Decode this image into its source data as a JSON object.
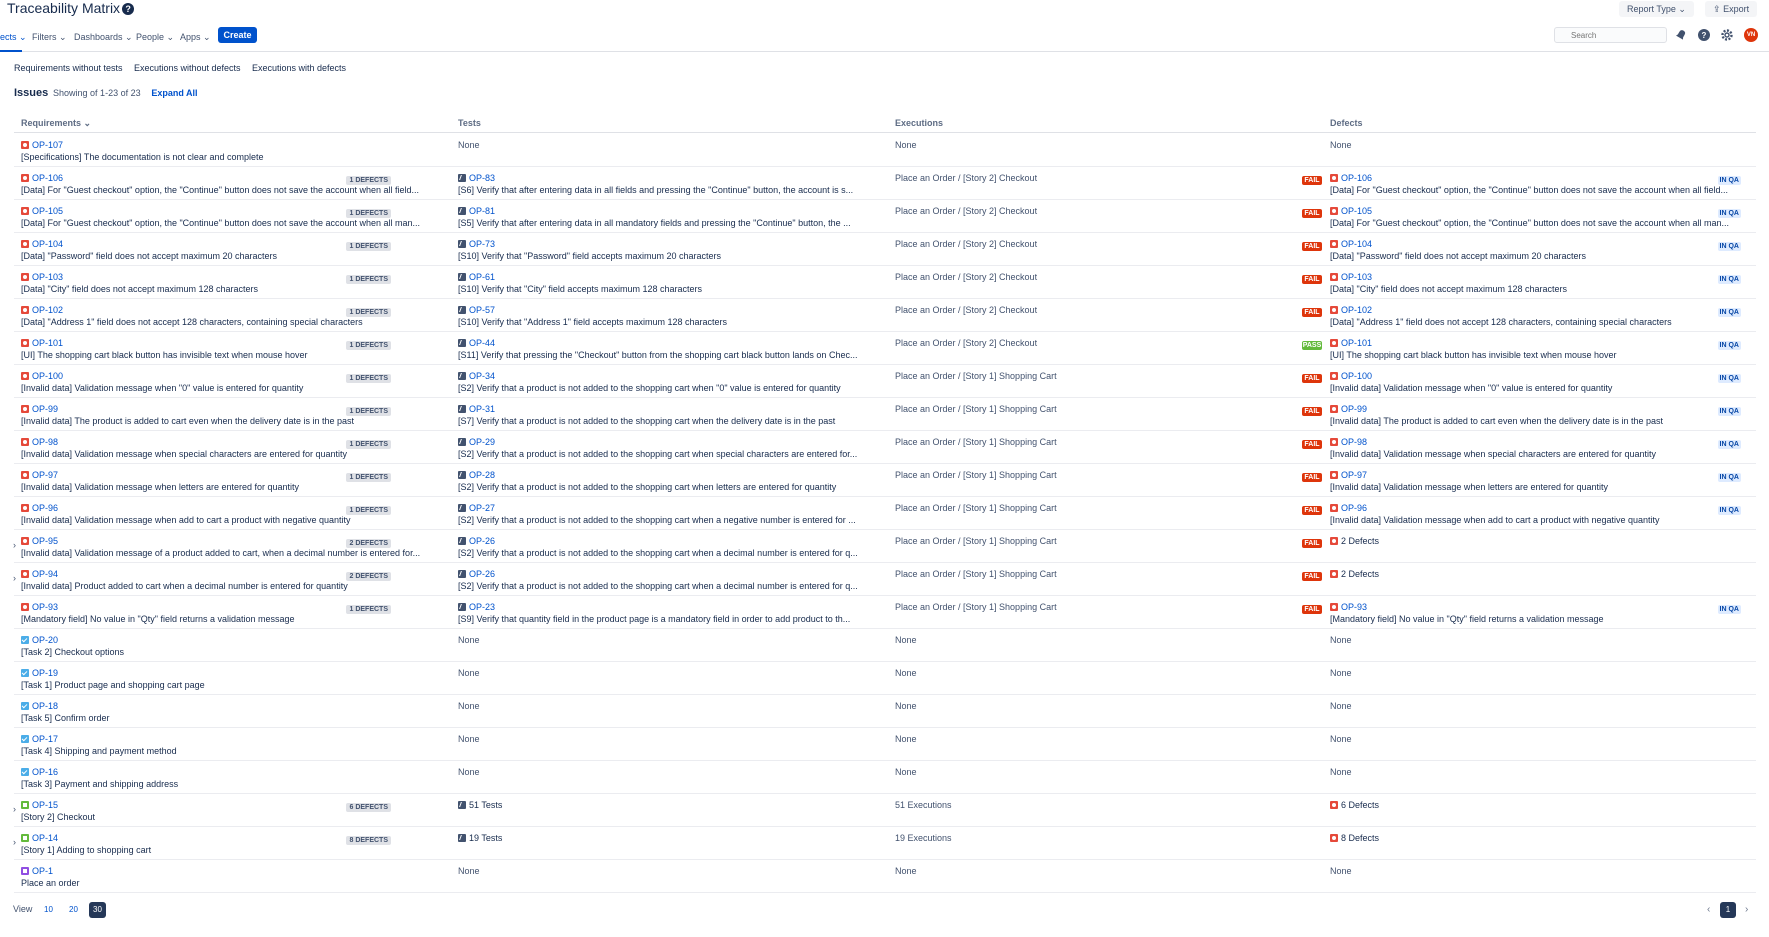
{
  "header": {
    "title": "Traceability Matrix",
    "report_type": "Report Type",
    "export": "Export"
  },
  "nav": {
    "items": [
      "ects",
      "Filters",
      "Dashboards",
      "People",
      "Apps"
    ],
    "create": "Create",
    "search_placeholder": "Search",
    "avatar_initials": "VN"
  },
  "subtabs": [
    "Requirements without tests",
    "Executions without defects",
    "Executions with defects"
  ],
  "issues": {
    "label": "Issues",
    "count": "Showing of 1-23 of 23",
    "expand": "Expand All"
  },
  "columns": {
    "req": "Requirements",
    "tests": "Tests",
    "exec": "Executions",
    "defects": "Defects"
  },
  "rows": [
    {
      "rkey": "OP-107",
      "rtitle": "[Specifications] The documentation is not clear and complete",
      "ricon": "bug",
      "badge": "",
      "tkey": "",
      "ttitle": "None",
      "exec": "None",
      "status": "",
      "dkey": "",
      "dtitle": "None",
      "dstatus": "",
      "expand": false
    },
    {
      "rkey": "OP-106",
      "rtitle": "[Data] For \"Guest checkout\" option, the \"Continue\" button does not save the account when all field...",
      "ricon": "bug",
      "badge": "1 DEFECTS",
      "tkey": "OP-83",
      "ttitle": "[S6] Verify that after entering data in all fields and pressing the \"Continue\" button, the account is s...",
      "exec": "Place an Order / [Story 2] Checkout",
      "status": "FAIL",
      "dkey": "OP-106",
      "dtitle": "[Data] For \"Guest checkout\" option, the \"Continue\" button does not save the account when all field...",
      "dstatus": "IN QA",
      "expand": false
    },
    {
      "rkey": "OP-105",
      "rtitle": "[Data] For \"Guest checkout\" option, the \"Continue\" button does not save the account when all man...",
      "ricon": "bug",
      "badge": "1 DEFECTS",
      "tkey": "OP-81",
      "ttitle": "[S5] Verify that after entering data in all mandatory fields and pressing the \"Continue\" button, the ...",
      "exec": "Place an Order / [Story 2] Checkout",
      "status": "FAIL",
      "dkey": "OP-105",
      "dtitle": "[Data] For \"Guest checkout\" option, the \"Continue\" button does not save the account when all man...",
      "dstatus": "IN QA",
      "expand": false
    },
    {
      "rkey": "OP-104",
      "rtitle": "[Data] \"Password\" field does not accept maximum 20 characters",
      "ricon": "bug",
      "badge": "1 DEFECTS",
      "tkey": "OP-73",
      "ttitle": "[S10] Verify that \"Password\" field accepts maximum 20 characters",
      "exec": "Place an Order / [Story 2] Checkout",
      "status": "FAIL",
      "dkey": "OP-104",
      "dtitle": "[Data] \"Password\" field does not accept maximum 20 characters",
      "dstatus": "IN QA",
      "expand": false
    },
    {
      "rkey": "OP-103",
      "rtitle": "[Data] \"City\" field does not accept maximum 128 characters",
      "ricon": "bug",
      "badge": "1 DEFECTS",
      "tkey": "OP-61",
      "ttitle": "[S10] Verify that \"City\" field accepts maximum 128 characters",
      "exec": "Place an Order / [Story 2] Checkout",
      "status": "FAIL",
      "dkey": "OP-103",
      "dtitle": "[Data] \"City\" field does not accept maximum 128 characters",
      "dstatus": "IN QA",
      "expand": false
    },
    {
      "rkey": "OP-102",
      "rtitle": "[Data] \"Address 1\" field does not accept 128 characters, containing special characters",
      "ricon": "bug",
      "badge": "1 DEFECTS",
      "tkey": "OP-57",
      "ttitle": "[S10] Verify that \"Address 1\" field accepts maximum 128 characters",
      "exec": "Place an Order / [Story 2] Checkout",
      "status": "FAIL",
      "dkey": "OP-102",
      "dtitle": "[Data] \"Address 1\" field does not accept 128 characters, containing special characters",
      "dstatus": "IN QA",
      "expand": false
    },
    {
      "rkey": "OP-101",
      "rtitle": "[UI] The shopping cart black button has invisible text when mouse hover",
      "ricon": "bug",
      "badge": "1 DEFECTS",
      "tkey": "OP-44",
      "ttitle": "[S11] Verify that pressing the \"Checkout\" button from the shopping cart black button lands on Chec...",
      "exec": "Place an Order / [Story 2] Checkout",
      "status": "PASS",
      "dkey": "OP-101",
      "dtitle": "[UI] The shopping cart black button has invisible text when mouse hover",
      "dstatus": "IN QA",
      "expand": false
    },
    {
      "rkey": "OP-100",
      "rtitle": "[Invalid data] Validation message when \"0\" value is entered for quantity",
      "ricon": "bug",
      "badge": "1 DEFECTS",
      "tkey": "OP-34",
      "ttitle": "[S2] Verify that a product is not added to the shopping cart when \"0\" value is entered for quantity",
      "exec": "Place an Order / [Story 1] Shopping Cart",
      "status": "FAIL",
      "dkey": "OP-100",
      "dtitle": "[Invalid data] Validation message when \"0\" value is entered for quantity",
      "dstatus": "IN QA",
      "expand": false
    },
    {
      "rkey": "OP-99",
      "rtitle": "[Invalid data] The product is added to cart even when the delivery date is in the past",
      "ricon": "bug",
      "badge": "1 DEFECTS",
      "tkey": "OP-31",
      "ttitle": "[S7] Verify that a product is not added to the shopping cart when the delivery date is in the past",
      "exec": "Place an Order / [Story 1] Shopping Cart",
      "status": "FAIL",
      "dkey": "OP-99",
      "dtitle": "[Invalid data] The product is added to cart even when the delivery date is in the past",
      "dstatus": "IN QA",
      "expand": false
    },
    {
      "rkey": "OP-98",
      "rtitle": "[Invalid data] Validation message when special characters are entered for quantity",
      "ricon": "bug",
      "badge": "1 DEFECTS",
      "tkey": "OP-29",
      "ttitle": "[S2] Verify that a product is not added to the shopping cart when special characters are entered for...",
      "exec": "Place an Order / [Story 1] Shopping Cart",
      "status": "FAIL",
      "dkey": "OP-98",
      "dtitle": "[Invalid data] Validation message when special characters are entered for quantity",
      "dstatus": "IN QA",
      "expand": false
    },
    {
      "rkey": "OP-97",
      "rtitle": "[Invalid data] Validation message when letters are entered for quantity",
      "ricon": "bug",
      "badge": "1 DEFECTS",
      "tkey": "OP-28",
      "ttitle": "[S2] Verify that a product is not added to the shopping cart when letters are entered for quantity",
      "exec": "Place an Order / [Story 1] Shopping Cart",
      "status": "FAIL",
      "dkey": "OP-97",
      "dtitle": "[Invalid data] Validation message when letters are entered for quantity",
      "dstatus": "IN QA",
      "expand": false
    },
    {
      "rkey": "OP-96",
      "rtitle": "[Invalid data] Validation message when add to cart a product with negative quantity",
      "ricon": "bug",
      "badge": "1 DEFECTS",
      "tkey": "OP-27",
      "ttitle": "[S2] Verify that a product is not added to the shopping cart when a negative number is entered for ...",
      "exec": "Place an Order / [Story 1] Shopping Cart",
      "status": "FAIL",
      "dkey": "OP-96",
      "dtitle": "[Invalid data] Validation message when add to cart a product with negative quantity",
      "dstatus": "IN QA",
      "expand": false
    },
    {
      "rkey": "OP-95",
      "rtitle": "[Invalid data] Validation message of a product added to cart, when a decimal number is entered for...",
      "ricon": "bug",
      "badge": "2 DEFECTS",
      "tkey": "OP-26",
      "ttitle": "[S2] Verify that a product is not added to the shopping cart when a decimal number is entered for q...",
      "exec": "Place an Order / [Story 1] Shopping Cart",
      "status": "FAIL",
      "dkey": "2 Defects",
      "dtitle": "",
      "dstatus": "",
      "expand": true
    },
    {
      "rkey": "OP-94",
      "rtitle": "[Invalid data] Product added to cart when a decimal number is entered for quantity",
      "ricon": "bug",
      "badge": "2 DEFECTS",
      "tkey": "OP-26",
      "ttitle": "[S2] Verify that a product is not added to the shopping cart when a decimal number is entered for q...",
      "exec": "Place an Order / [Story 1] Shopping Cart",
      "status": "FAIL",
      "dkey": "2 Defects",
      "dtitle": "",
      "dstatus": "",
      "expand": true
    },
    {
      "rkey": "OP-93",
      "rtitle": "[Mandatory field] No value in \"Qty\" field returns a validation message",
      "ricon": "bug",
      "badge": "1 DEFECTS",
      "tkey": "OP-23",
      "ttitle": "[S9] Verify that quantity field in the product page is a mandatory field in order to add product to th...",
      "exec": "Place an Order / [Story 1] Shopping Cart",
      "status": "FAIL",
      "dkey": "OP-93",
      "dtitle": "[Mandatory field] No value in \"Qty\" field returns a validation message",
      "dstatus": "IN QA",
      "expand": false
    },
    {
      "rkey": "OP-20",
      "rtitle": "[Task 2] Checkout options",
      "ricon": "task",
      "badge": "",
      "tkey": "",
      "ttitle": "None",
      "exec": "None",
      "status": "",
      "dkey": "",
      "dtitle": "None",
      "dstatus": "",
      "expand": false
    },
    {
      "rkey": "OP-19",
      "rtitle": "[Task 1] Product page and shopping cart page",
      "ricon": "task",
      "badge": "",
      "tkey": "",
      "ttitle": "None",
      "exec": "None",
      "status": "",
      "dkey": "",
      "dtitle": "None",
      "dstatus": "",
      "expand": false
    },
    {
      "rkey": "OP-18",
      "rtitle": "[Task 5] Confirm order",
      "ricon": "task",
      "badge": "",
      "tkey": "",
      "ttitle": "None",
      "exec": "None",
      "status": "",
      "dkey": "",
      "dtitle": "None",
      "dstatus": "",
      "expand": false
    },
    {
      "rkey": "OP-17",
      "rtitle": "[Task 4] Shipping and payment method",
      "ricon": "task",
      "badge": "",
      "tkey": "",
      "ttitle": "None",
      "exec": "None",
      "status": "",
      "dkey": "",
      "dtitle": "None",
      "dstatus": "",
      "expand": false
    },
    {
      "rkey": "OP-16",
      "rtitle": "[Task 3] Payment and shipping address",
      "ricon": "task",
      "badge": "",
      "tkey": "",
      "ttitle": "None",
      "exec": "None",
      "status": "",
      "dkey": "",
      "dtitle": "None",
      "dstatus": "",
      "expand": false
    },
    {
      "rkey": "OP-15",
      "rtitle": "[Story 2] Checkout",
      "ricon": "story",
      "badge": "6 DEFECTS",
      "tkey": "51 Tests",
      "ttitle": "",
      "exec": "51 Executions",
      "status": "",
      "dkey": "6 Defects",
      "dtitle": "",
      "dstatus": "",
      "expand": true
    },
    {
      "rkey": "OP-14",
      "rtitle": "[Story 1] Adding to shopping cart",
      "ricon": "story",
      "badge": "8 DEFECTS",
      "tkey": "19 Tests",
      "ttitle": "",
      "exec": "19 Executions",
      "status": "",
      "dkey": "8 Defects",
      "dtitle": "",
      "dstatus": "",
      "expand": true
    },
    {
      "rkey": "OP-1",
      "rtitle": "Place an order",
      "ricon": "epic",
      "badge": "",
      "tkey": "",
      "ttitle": "None",
      "exec": "None",
      "status": "",
      "dkey": "",
      "dtitle": "None",
      "dstatus": "",
      "expand": false
    }
  ],
  "pager": {
    "view_label": "View",
    "sizes": [
      "10",
      "20",
      "30"
    ],
    "selected_size": "30",
    "page": "1"
  }
}
